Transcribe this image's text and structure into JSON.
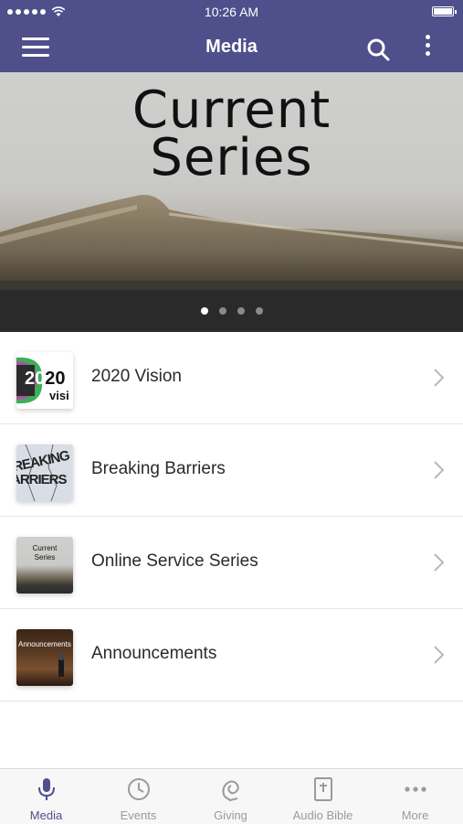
{
  "status_bar": {
    "time": "10:26 AM"
  },
  "header": {
    "title": "Media"
  },
  "hero": {
    "title_line1": "Current",
    "title_line2": "Series",
    "page_count": 4,
    "active_page": 1
  },
  "media_list": [
    {
      "label": "2020 Vision",
      "thumb_text1": "20",
      "thumb_text2": "20",
      "thumb_text3": "visi"
    },
    {
      "label": "Breaking Barriers",
      "thumb_text1": "REAKING",
      "thumb_text2": "ARRIERS"
    },
    {
      "label": "Online Service Series",
      "thumb_text1": "Current",
      "thumb_text2": "Series"
    },
    {
      "label": "Announcements",
      "thumb_text1": "Announcements"
    }
  ],
  "tab_bar": [
    {
      "label": "Media",
      "icon": "microphone-icon",
      "active": true
    },
    {
      "label": "Events",
      "icon": "clock-icon",
      "active": false
    },
    {
      "label": "Giving",
      "icon": "giving-icon",
      "active": false
    },
    {
      "label": "Audio Bible",
      "icon": "bible-icon",
      "active": false
    },
    {
      "label": "More",
      "icon": "ellipsis-icon",
      "active": false
    }
  ],
  "colors": {
    "brand": "#4f4f8c",
    "tab_inactive": "#9a9a9a"
  }
}
